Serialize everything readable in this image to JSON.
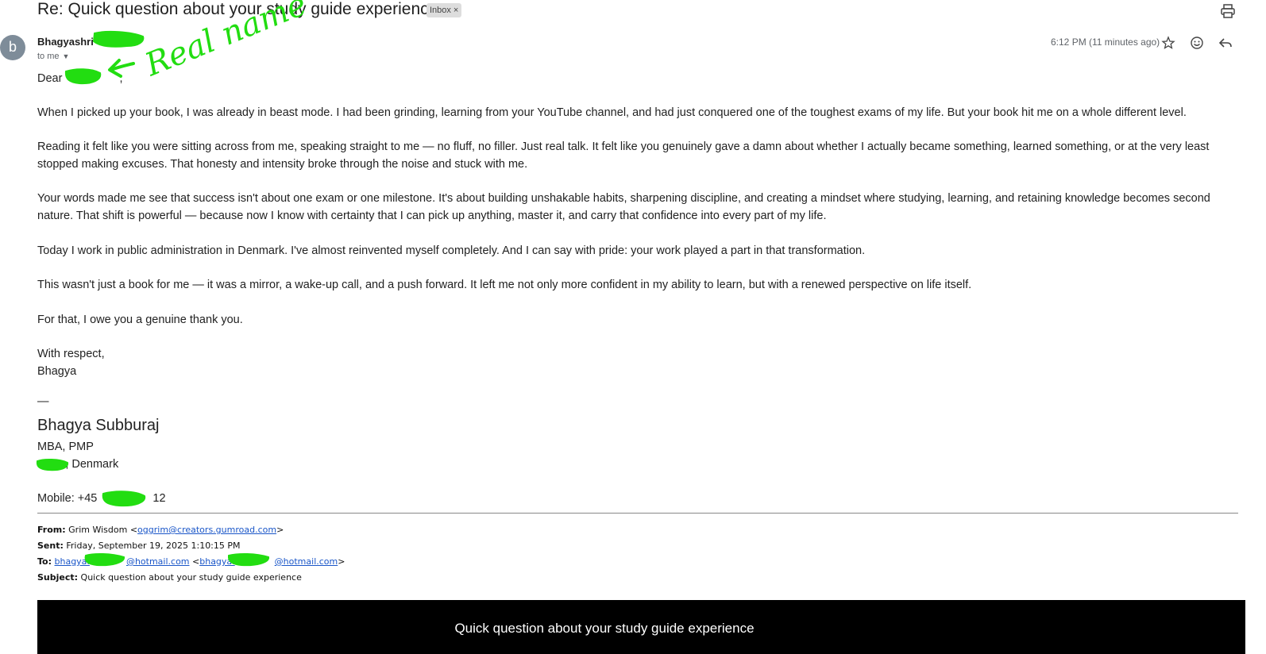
{
  "email": {
    "subject": "Re: Quick question about your study guide experience",
    "label": "Inbox",
    "label_remove": "×",
    "sender_initial": "b",
    "sender_name": "Bhagyashri",
    "to_line": "to me",
    "timestamp": "6:12 PM (11 minutes ago)",
    "icons": [
      "print-icon",
      "star-icon",
      "emoji-icon",
      "reply-icon",
      "chevron-down-icon"
    ]
  },
  "annotation": {
    "text": "Real name",
    "color": "#22dd11"
  },
  "body": {
    "greeting": "Dear",
    "greeting_suffix": ",",
    "paragraphs": [
      "When I picked up your book, I was already in beast mode. I had been grinding, learning from your YouTube channel, and had just conquered one of the toughest exams of my life. But your book hit me on a whole different level.",
      "Reading it felt like you were sitting across from me, speaking straight to me — no fluff, no filler. Just real talk. It felt like you genuinely gave a damn about whether I actually became something, learned something, or at the very least stopped making excuses. That honesty and intensity broke through the noise and stuck with me.",
      "Your words made me see that success isn't about one exam or one milestone. It's about building unshakable habits, sharpening discipline, and creating a mindset where studying, learning, and retaining knowledge becomes second nature. That shift is powerful — because now I know with certainty that I can pick up anything, master it, and carry that confidence into every part of my life.",
      "Today I work in public administration in Denmark. I've almost reinvented myself completely. And I can say with pride: your work played a part in that transformation.",
      "This wasn't just a book for me — it was a mirror, a wake-up call, and a push forward. It left me not only more confident in my ability to learn, but with a renewed perspective on life itself.",
      "For that, I owe you a genuine thank you."
    ],
    "closing": "With respect,",
    "closing_name": "Bhagya"
  },
  "signature": {
    "dash": "—",
    "name": "Bhagya Subburaj",
    "credentials": "MBA, PMP",
    "location": "us, Denmark",
    "mobile": "Mobile: +45",
    "mobile_tail": "12"
  },
  "quoted_header": {
    "from_label": "From:",
    "from_name": "Grim Wisdom <",
    "from_email": "oggrim@creators.gumroad.com",
    "from_close": ">",
    "sent_label": "Sent:",
    "sent_value": "Friday, September 19, 2025 1:10:15 PM",
    "to_label": "To:",
    "to_email_1": "bhagya.",
    "to_email_1_domain": "@hotmail.com",
    "to_open": " <",
    "to_email_2": "bhagya.",
    "to_email_2_domain": "@hotmail.com",
    "to_close": ">",
    "subject_label": "Subject:",
    "subject_value": "Quick question about your study guide experience"
  },
  "banner": {
    "title": "Quick question about your study guide experience",
    "background": "#000000"
  }
}
